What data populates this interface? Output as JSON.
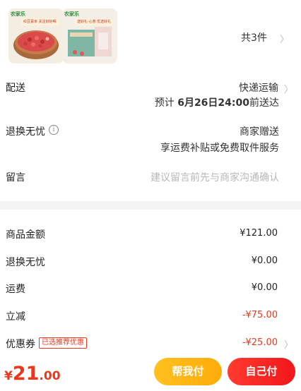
{
  "products": {
    "item1": {
      "brand": "农家乐",
      "tag": "红豆薏米 关注好好喝"
    },
    "item2": {
      "brand": "农家乐",
      "tag": "送好礼·心意 优选好礼"
    },
    "count_prefix": "共",
    "count": "3",
    "count_suffix": "件"
  },
  "delivery": {
    "label": "配送",
    "method": "快递运输",
    "eta_prefix": "预计",
    "eta_date": "6月26日24:00",
    "eta_suffix": "前送达"
  },
  "return_worry": {
    "label": "退换无忧",
    "value": "商家赠送",
    "detail": "享运费补贴或免费取件服务"
  },
  "message": {
    "label": "留言",
    "placeholder": "建议留言前先与商家沟通确认"
  },
  "amounts": {
    "goods_label": "商品金额",
    "goods_value": "¥121.00",
    "return_label": "退换无忧",
    "return_value": "¥0.00",
    "shipping_label": "运费",
    "shipping_value": "¥0.00",
    "discount_label": "立减",
    "discount_value": "-¥75.00",
    "coupon_label": "优惠券",
    "coupon_tag": "已选推荐优惠",
    "coupon_value": "-¥25.00"
  },
  "bottom": {
    "price_symbol": "¥",
    "price_int": "21",
    "price_dec": ".00",
    "friend_pay": "帮我付",
    "self_pay": "自己付"
  },
  "colors": {
    "accent_red": "#e8391f",
    "friend_button": "#ffb80f",
    "self_button": "#f0191b"
  }
}
